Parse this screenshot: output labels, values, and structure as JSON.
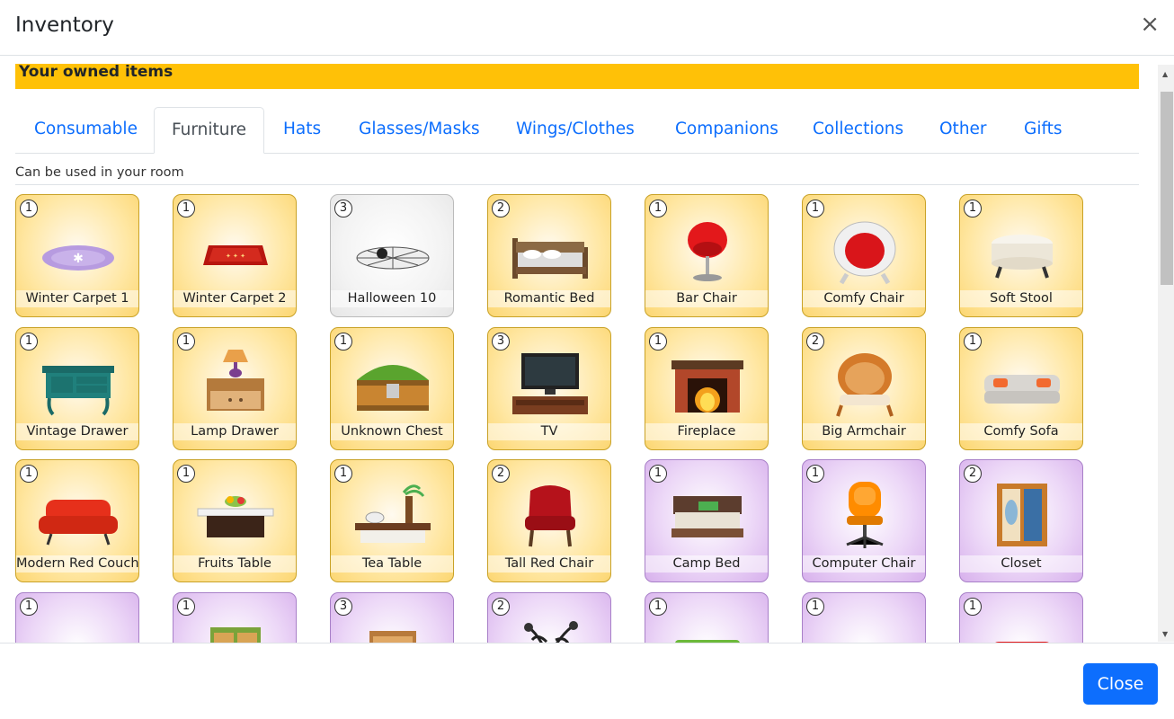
{
  "header": {
    "title": "Inventory",
    "close_icon": "×"
  },
  "banner": {
    "text": "Your owned items"
  },
  "tabs": [
    {
      "label": "Consumable"
    },
    {
      "label": "Furniture"
    },
    {
      "label": "Hats"
    },
    {
      "label": "Glasses/Masks"
    },
    {
      "label": "Wings/Clothes"
    },
    {
      "label": "Companions"
    },
    {
      "label": "Collections"
    },
    {
      "label": "Other"
    },
    {
      "label": "Gifts"
    }
  ],
  "active_tab": "Furniture",
  "section": {
    "label": "Can be used in your room"
  },
  "items": [
    {
      "name": "Winter Carpet 1",
      "count": "1",
      "theme": "gold",
      "icon": "purple-round-carpet"
    },
    {
      "name": "Winter Carpet 2",
      "count": "1",
      "theme": "gold",
      "icon": "red-rug"
    },
    {
      "name": "Halloween 10",
      "count": "3",
      "theme": "grey",
      "icon": "spiderweb-rug"
    },
    {
      "name": "Romantic Bed",
      "count": "2",
      "theme": "gold",
      "icon": "bed"
    },
    {
      "name": "Bar Chair",
      "count": "1",
      "theme": "gold",
      "icon": "red-bar-chair"
    },
    {
      "name": "Comfy Chair",
      "count": "1",
      "theme": "gold",
      "icon": "egg-chair"
    },
    {
      "name": "Soft Stool",
      "count": "1",
      "theme": "gold",
      "icon": "stool"
    },
    {
      "name": "Vintage Drawer",
      "count": "1",
      "theme": "gold",
      "icon": "teal-drawer"
    },
    {
      "name": "Lamp Drawer",
      "count": "1",
      "theme": "gold",
      "icon": "lamp-drawer"
    },
    {
      "name": "Unknown Chest",
      "count": "1",
      "theme": "gold",
      "icon": "chest"
    },
    {
      "name": "TV",
      "count": "3",
      "theme": "gold",
      "icon": "tv"
    },
    {
      "name": "Fireplace",
      "count": "1",
      "theme": "gold",
      "icon": "fireplace"
    },
    {
      "name": "Big Armchair",
      "count": "2",
      "theme": "gold",
      "icon": "wicker-armchair"
    },
    {
      "name": "Comfy Sofa",
      "count": "1",
      "theme": "gold",
      "icon": "grey-sofa"
    },
    {
      "name": "Modern Red Couch",
      "count": "1",
      "theme": "gold",
      "icon": "red-couch"
    },
    {
      "name": "Fruits Table",
      "count": "1",
      "theme": "gold",
      "icon": "fruit-table"
    },
    {
      "name": "Tea Table",
      "count": "1",
      "theme": "gold",
      "icon": "tea-table"
    },
    {
      "name": "Tall Red Chair",
      "count": "2",
      "theme": "gold",
      "icon": "wingback-chair"
    },
    {
      "name": "Camp Bed",
      "count": "1",
      "theme": "purple",
      "icon": "camp-bed"
    },
    {
      "name": "Computer Chair",
      "count": "1",
      "theme": "purple",
      "icon": "office-chair"
    },
    {
      "name": "Closet",
      "count": "2",
      "theme": "purple",
      "icon": "closet"
    },
    {
      "name": "",
      "count": "1",
      "theme": "purple",
      "icon": "desk"
    },
    {
      "name": "",
      "count": "1",
      "theme": "purple",
      "icon": "green-cabinet"
    },
    {
      "name": "",
      "count": "3",
      "theme": "purple",
      "icon": "wooden-drawer"
    },
    {
      "name": "",
      "count": "2",
      "theme": "purple",
      "icon": "bonsai-tree"
    },
    {
      "name": "",
      "count": "1",
      "theme": "purple",
      "icon": "green-sofa"
    },
    {
      "name": "",
      "count": "1",
      "theme": "purple",
      "icon": "orange-sofa"
    },
    {
      "name": "",
      "count": "1",
      "theme": "purple",
      "icon": "red-sofa"
    }
  ],
  "footer": {
    "close_label": "Close"
  },
  "colors": {
    "primary": "#0d6efd",
    "banner": "#ffc107"
  }
}
